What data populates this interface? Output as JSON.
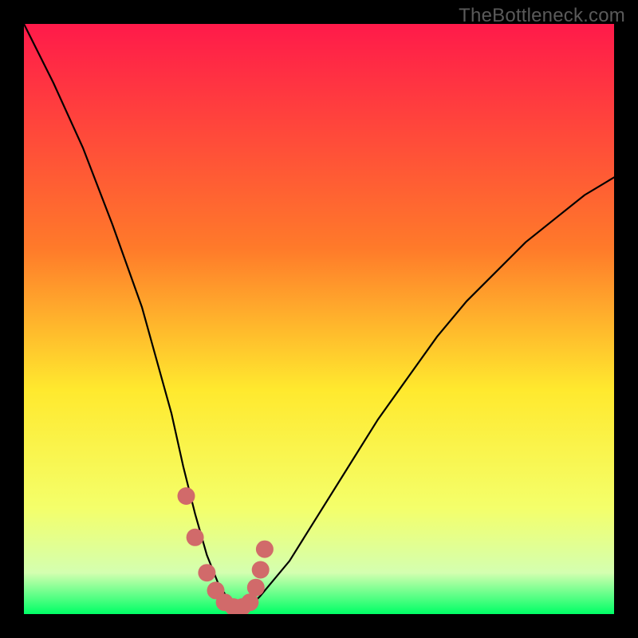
{
  "watermark": "TheBottleneck.com",
  "colors": {
    "background": "#000000",
    "gradient_top": "#ff1a4a",
    "gradient_mid1": "#ff7a2a",
    "gradient_mid2": "#ffe92e",
    "gradient_mid3": "#f4ff6a",
    "gradient_low": "#d4ffb0",
    "gradient_bottom": "#00ff66",
    "curve": "#000000",
    "marker": "#d16a6a"
  },
  "chart_data": {
    "type": "line",
    "title": "",
    "xlabel": "",
    "ylabel": "",
    "xlim": [
      0,
      100
    ],
    "ylim": [
      0,
      100
    ],
    "series": [
      {
        "name": "bottleneck-curve",
        "x": [
          0,
          5,
          10,
          15,
          20,
          25,
          27,
          29,
          31,
          33,
          35,
          36,
          37,
          38,
          40,
          45,
          50,
          55,
          60,
          65,
          70,
          75,
          80,
          85,
          90,
          95,
          100
        ],
        "y": [
          100,
          90,
          79,
          66,
          52,
          34,
          25,
          17,
          10,
          5,
          2,
          1,
          1,
          1,
          3,
          9,
          17,
          25,
          33,
          40,
          47,
          53,
          58,
          63,
          67,
          71,
          74
        ]
      }
    ],
    "markers": {
      "name": "highlight-band",
      "x": [
        27.5,
        29,
        31,
        32.5,
        34,
        35.5,
        37,
        38.3,
        39.3,
        40.1,
        40.8
      ],
      "y": [
        20,
        13,
        7,
        4,
        2,
        1.2,
        1.2,
        2,
        4.5,
        7.5,
        11
      ]
    }
  }
}
